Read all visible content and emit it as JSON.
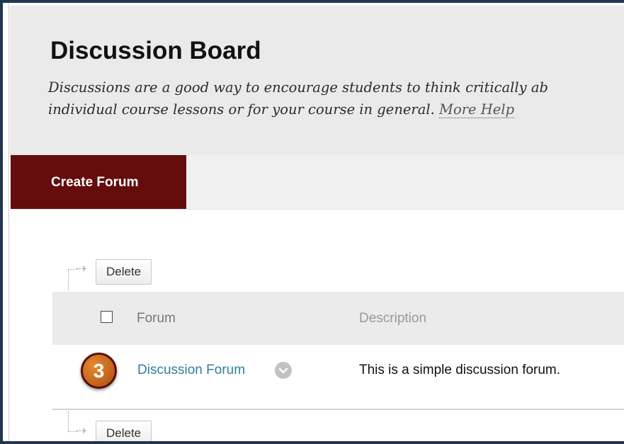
{
  "header": {
    "title": "Discussion Board",
    "description_line1": "Discussions are a good way to encourage students to think critically ab",
    "description_line2": "individual course lessons or for your course in general.",
    "more_help": "More Help"
  },
  "actionbar": {
    "create_forum": "Create Forum"
  },
  "list_actions": {
    "delete_label": "Delete"
  },
  "table": {
    "columns": [
      "Forum",
      "Description"
    ],
    "rows": [
      {
        "badge": "3",
        "forum": "Discussion Forum",
        "description": "This is a simple discussion forum."
      }
    ]
  },
  "colors": {
    "create_forum_bg": "#650c0c",
    "link": "#2f7f99",
    "badge": "#c4661a",
    "frame": "#1f3550"
  },
  "icons": {
    "row_menu": "chevron-down-icon",
    "action_arrow": "arrow-right-icon"
  }
}
